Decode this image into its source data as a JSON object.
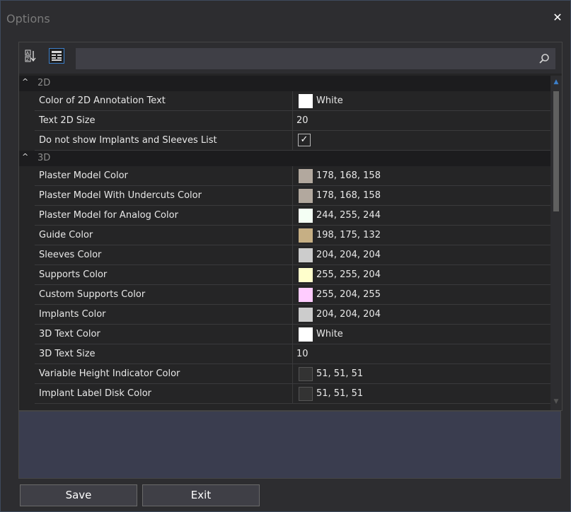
{
  "window": {
    "title": "Options"
  },
  "search": {
    "placeholder": ""
  },
  "categories": [
    {
      "label": "2D",
      "rows": [
        {
          "name": "Color of 2D Annotation Text",
          "type": "color",
          "swatch": "#ffffff",
          "value": "White"
        },
        {
          "name": "Text 2D Size",
          "type": "text",
          "value": "20"
        },
        {
          "name": "Do not show Implants and Sleeves List",
          "type": "checkbox",
          "checked": true
        }
      ]
    },
    {
      "label": "3D",
      "rows": [
        {
          "name": "Plaster Model Color",
          "type": "color",
          "swatch": "#b2a89e",
          "value": "178, 168, 158"
        },
        {
          "name": "Plaster Model With Undercuts Color",
          "type": "color",
          "swatch": "#b2a89e",
          "value": "178, 168, 158"
        },
        {
          "name": "Plaster Model for Analog Color",
          "type": "color",
          "swatch": "#f4fff4",
          "value": "244, 255, 244"
        },
        {
          "name": "Guide Color",
          "type": "color",
          "swatch": "#c6af84",
          "value": "198, 175, 132"
        },
        {
          "name": "Sleeves Color",
          "type": "color",
          "swatch": "#cccccc",
          "value": "204, 204, 204"
        },
        {
          "name": "Supports Color",
          "type": "color",
          "swatch": "#ffffcc",
          "value": "255, 255, 204"
        },
        {
          "name": "Custom Supports Color",
          "type": "color",
          "swatch": "#ffccff",
          "value": "255, 204, 255"
        },
        {
          "name": "Implants Color",
          "type": "color",
          "swatch": "#cccccc",
          "value": "204, 204, 204"
        },
        {
          "name": "3D Text Color",
          "type": "color",
          "swatch": "#ffffff",
          "value": "White"
        },
        {
          "name": "3D Text Size",
          "type": "text",
          "value": "10"
        },
        {
          "name": "Variable Height Indicator Color",
          "type": "color",
          "swatch": "#333333",
          "value": "51, 51, 51"
        },
        {
          "name": "Implant Label Disk Color",
          "type": "color",
          "swatch": "#333333",
          "value": "51, 51, 51"
        }
      ]
    }
  ],
  "buttons": {
    "save": "Save",
    "exit": "Exit"
  }
}
